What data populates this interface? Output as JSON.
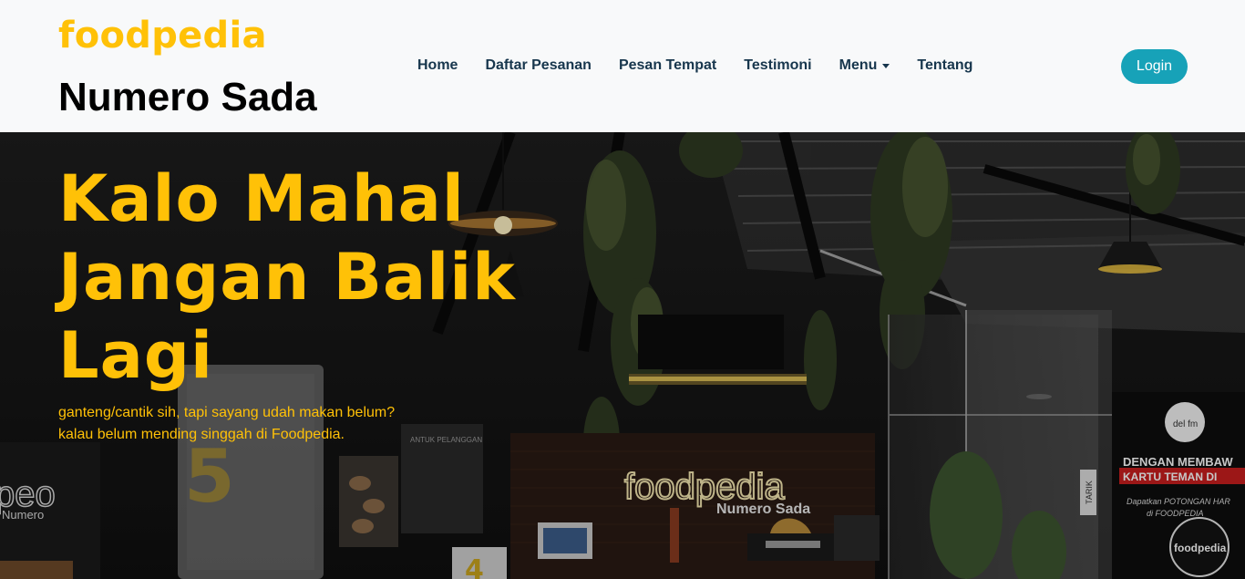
{
  "brand": {
    "name": "foodpedia",
    "subtitle": "Numero Sada"
  },
  "nav": {
    "items": [
      {
        "label": "Home"
      },
      {
        "label": "Daftar Pesanan"
      },
      {
        "label": "Pesan Tempat"
      },
      {
        "label": "Testimoni"
      },
      {
        "label": "Menu",
        "dropdown": true
      },
      {
        "label": "Tentang"
      }
    ],
    "login_label": "Login"
  },
  "hero": {
    "title_lines": [
      "Kalo Mahal",
      "Jangan Balik",
      "Lagi"
    ],
    "desc_lines": [
      "ganteng/cantik sih, tapi sayang udah makan belum?",
      "kalau belum mending singgah di Foodpedia."
    ],
    "scene": {
      "sign_name": "foodpedia",
      "sign_sub": "Numero Sada",
      "left_sign_partial": "peo",
      "left_sign_partial_sub": "Numero",
      "number_five": "5",
      "number_four": "4",
      "banner_top": "DENGAN MEMBAW",
      "banner_mid": "KARTU TEMAN DI",
      "banner_small": "Dapatkan POTONGAN HAR",
      "banner_small2": "di FOODPEDIA",
      "banner_radio": "del fm",
      "banner_logo": "foodpedia",
      "door_label": "TARIK",
      "wall_sign": "ANTUK PELANGGAN"
    }
  },
  "colors": {
    "accent": "#ffc107",
    "login": "#17a2b8",
    "nav_text": "#17364d",
    "navbar_bg": "#f8f9fa"
  }
}
